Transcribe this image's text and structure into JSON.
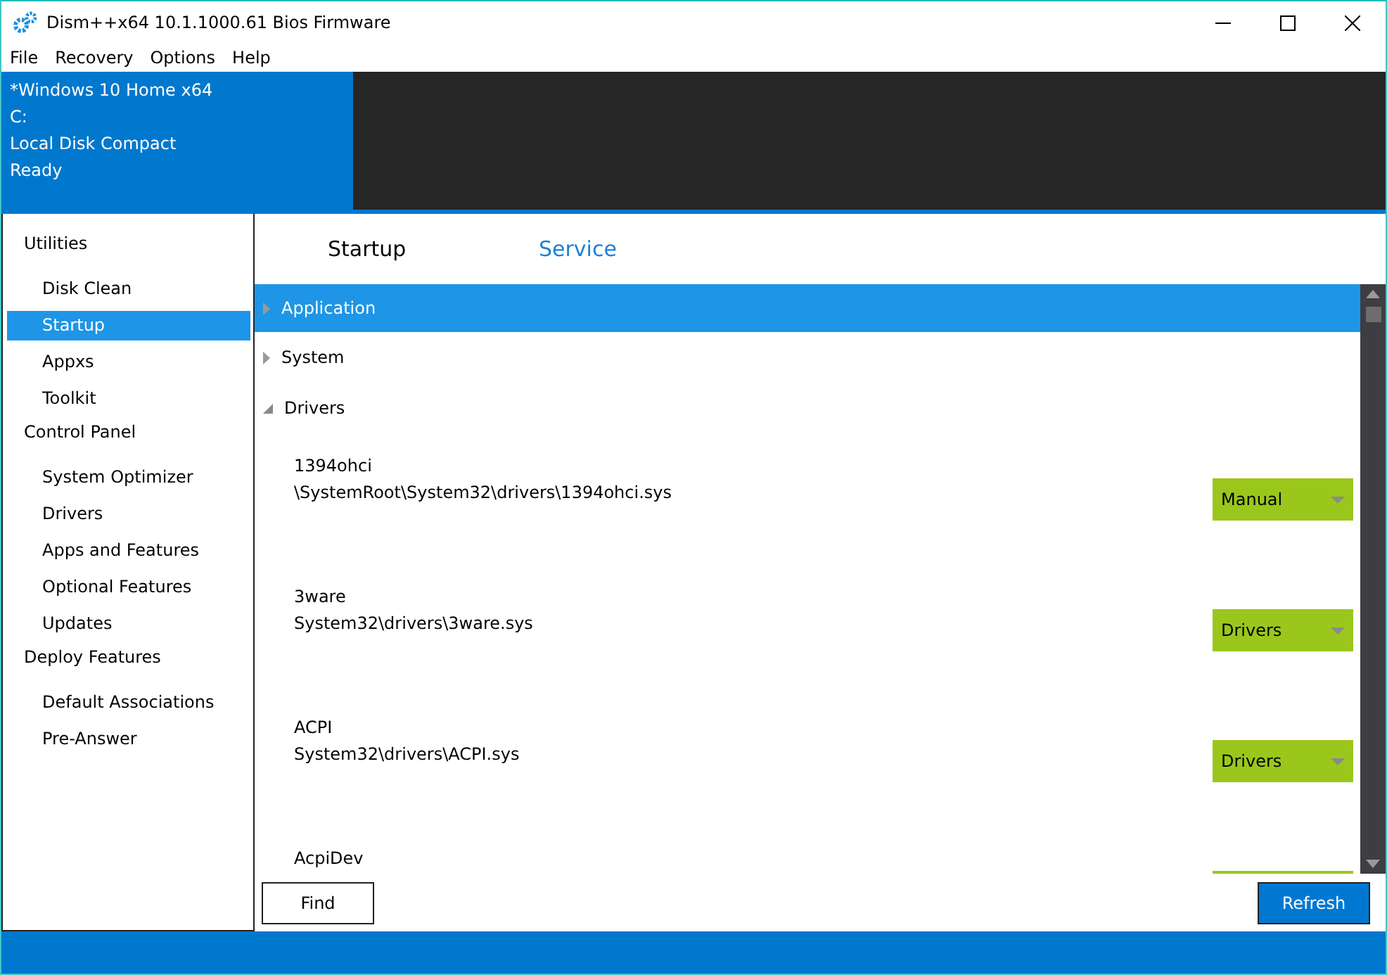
{
  "window": {
    "title": "Dism++x64 10.1.1000.61 Bios Firmware"
  },
  "menu": [
    "File",
    "Recovery",
    "Options",
    "Help"
  ],
  "info": [
    "*Windows 10 Home x64",
    "C:",
    "Local Disk Compact",
    "Ready"
  ],
  "sidebar": {
    "groups": [
      {
        "label": "Utilities",
        "items": [
          {
            "label": "Disk Clean",
            "selected": false
          },
          {
            "label": "Startup",
            "selected": true
          },
          {
            "label": "Appxs",
            "selected": false
          },
          {
            "label": "Toolkit",
            "selected": false
          }
        ]
      },
      {
        "label": "Control Panel",
        "items": [
          {
            "label": "System Optimizer",
            "selected": false
          },
          {
            "label": "Drivers",
            "selected": false
          },
          {
            "label": "Apps and Features",
            "selected": false
          },
          {
            "label": "Optional Features",
            "selected": false
          },
          {
            "label": "Updates",
            "selected": false
          }
        ]
      },
      {
        "label": "Deploy Features",
        "items": [
          {
            "label": "Default Associations",
            "selected": false
          },
          {
            "label": "Pre-Answer",
            "selected": false
          }
        ]
      }
    ]
  },
  "tabs": [
    {
      "label": "Startup",
      "selected": false
    },
    {
      "label": "Service",
      "selected": true
    }
  ],
  "tree": [
    {
      "label": "Application",
      "selected": true,
      "expanded": false
    },
    {
      "label": "System",
      "selected": false,
      "expanded": false
    },
    {
      "label": "Drivers",
      "selected": false,
      "expanded": true,
      "children": [
        {
          "name": "1394ohci",
          "path": "\\SystemRoot\\System32\\drivers\\1394ohci.sys",
          "startup": "Manual"
        },
        {
          "name": "3ware",
          "path": "System32\\drivers\\3ware.sys",
          "startup": "Drivers"
        },
        {
          "name": "ACPI",
          "path": "System32\\drivers\\ACPI.sys",
          "startup": "Drivers"
        },
        {
          "name": "AcpiDev"
        }
      ]
    }
  ],
  "buttons": {
    "find": "Find",
    "refresh": "Refresh"
  }
}
